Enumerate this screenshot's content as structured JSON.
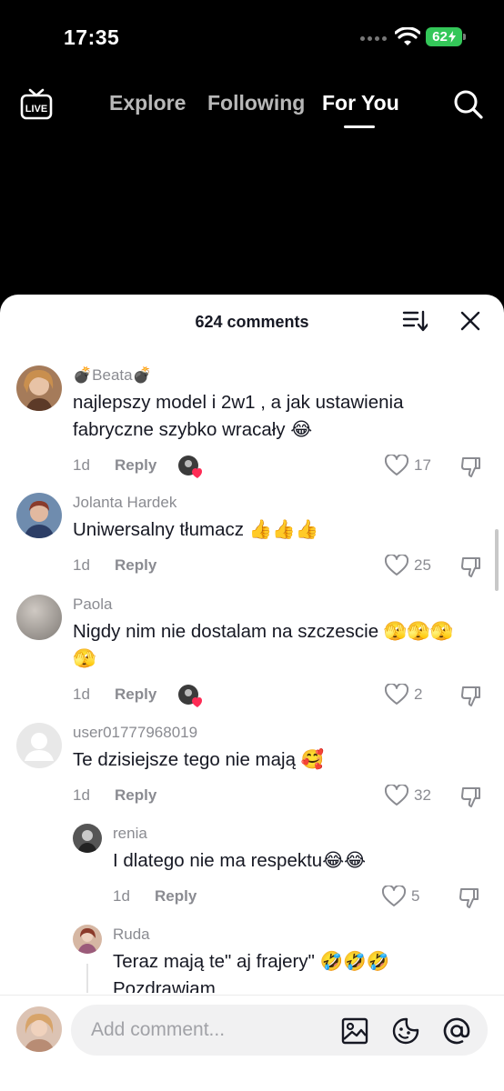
{
  "status": {
    "time": "17:35",
    "battery": "62"
  },
  "nav": {
    "tabs": [
      {
        "label": "Explore"
      },
      {
        "label": "Following"
      },
      {
        "label": "For You"
      }
    ],
    "live_label": "LIVE"
  },
  "comments_header": {
    "count_label": "624 comments"
  },
  "comments": [
    {
      "user": "💣Beata💣",
      "text": "najlepszy model i 2w1 , a jak ustawienia fabryczne szybko wracały 😂",
      "date": "1d",
      "reply": "Reply",
      "likes": "17",
      "creator_liked": true
    },
    {
      "user": "Jolanta Hardek",
      "text": "Uniwersalny tłumacz 👍👍👍",
      "date": "1d",
      "reply": "Reply",
      "likes": "25",
      "creator_liked": false
    },
    {
      "user": "Paola",
      "text": "Nigdy nim nie dostalam na szczescie 🫣🫣🫣🫣",
      "date": "1d",
      "reply": "Reply",
      "likes": "2",
      "creator_liked": true
    },
    {
      "user": "user01777968019",
      "text": "Te dzisiejsze tego nie mają 🥰",
      "date": "1d",
      "reply": "Reply",
      "likes": "32",
      "creator_liked": false
    }
  ],
  "replies": [
    {
      "user": "renia",
      "text": "I dlatego nie ma respektu😂😂",
      "date": "1d",
      "reply": "Reply",
      "likes": "5"
    },
    {
      "user": "Ruda",
      "text": "Teraz mają te\" aj frajery\" 🤣🤣🤣 Pozdrawiam"
    }
  ],
  "input": {
    "placeholder": "Add comment..."
  },
  "colors": {
    "accent_heart": "#fe2c55",
    "battery": "#34c759",
    "text": "#161823",
    "muted": "#8a8b91"
  }
}
